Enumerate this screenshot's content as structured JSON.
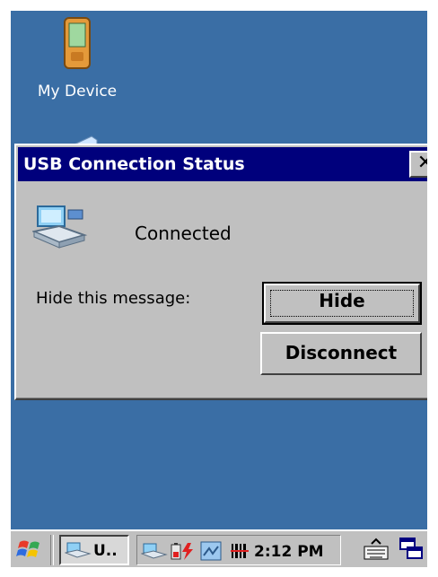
{
  "desktop": {
    "icons": [
      {
        "label": "My Device"
      }
    ]
  },
  "dialog": {
    "title": "USB Connection Status",
    "close_label": "✕",
    "status_text": "Connected",
    "hide_prompt": "Hide this message:",
    "hide_button": "Hide",
    "disconnect_button": "Disconnect"
  },
  "taskbar": {
    "active_task_label": "U..",
    "clock": "2:12 PM"
  },
  "colors": {
    "desktop": "#3a6ea5",
    "titlebar": "#00007c",
    "face": "#c0c0c0"
  }
}
